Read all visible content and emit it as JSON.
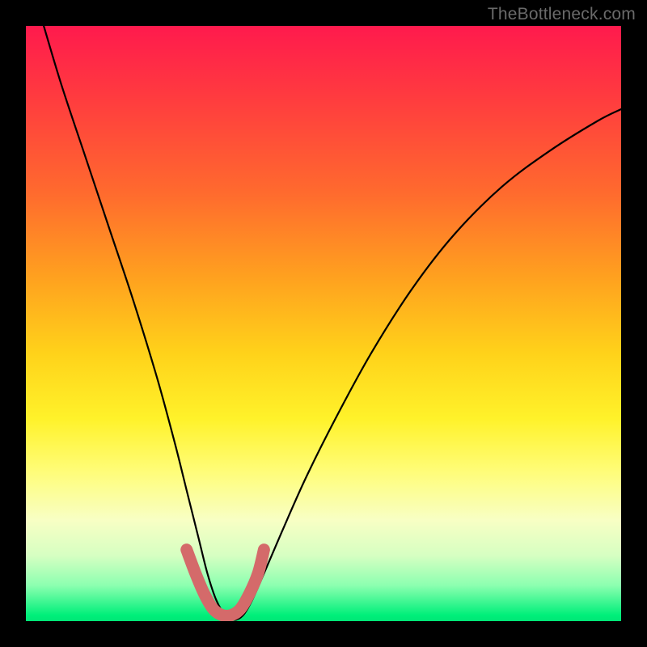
{
  "watermark": "TheBottleneck.com",
  "chart_data": {
    "type": "line",
    "title": "",
    "xlabel": "",
    "ylabel": "",
    "xlim": [
      0,
      100
    ],
    "ylim": [
      0,
      100
    ],
    "series": [
      {
        "name": "bottleneck-curve",
        "x": [
          3,
          6,
          10,
          14,
          18,
          22,
          25,
          27,
          29,
          30.5,
          32,
          33.5,
          35,
          36.5,
          38,
          40,
          43,
          47,
          52,
          58,
          65,
          72,
          80,
          88,
          96,
          100
        ],
        "values": [
          100,
          90,
          78,
          66,
          54,
          41,
          30,
          22,
          14,
          8,
          3.5,
          1,
          0.2,
          1,
          3.5,
          8,
          15,
          24,
          34,
          45,
          56,
          65,
          73,
          79,
          84,
          86
        ]
      },
      {
        "name": "sweet-spot-overlay",
        "x": [
          27,
          28.5,
          30,
          31.5,
          33,
          34.5,
          36,
          37.5,
          39,
          40
        ],
        "values": [
          12,
          8,
          4.5,
          2,
          1,
          1,
          2,
          4.5,
          8,
          12
        ]
      }
    ],
    "background_gradient": {
      "top": "#ff1a4d",
      "upper_mid": "#ffa01f",
      "mid": "#fff22a",
      "lower_mid": "#d6ffc2",
      "bottom": "#00e676"
    },
    "overlay_color": "#d46a6a"
  }
}
